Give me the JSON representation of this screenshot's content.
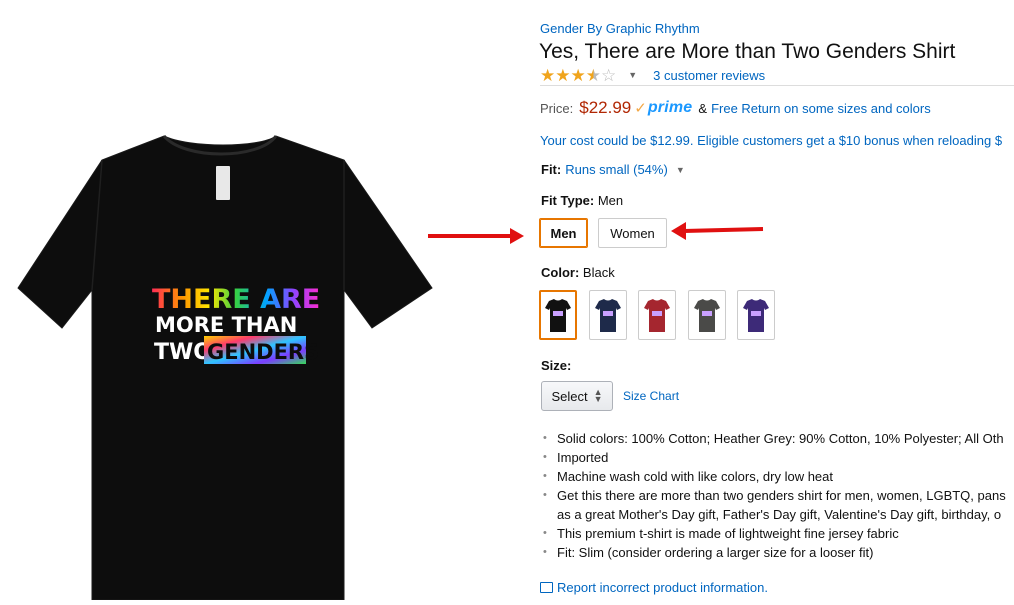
{
  "product": {
    "brand": "Gender By Graphic Rhythm",
    "title": "Yes, There are More than Two Genders Shirt",
    "rating": {
      "stars": 3.5,
      "review_count_label": "3 customer reviews",
      "caret_icon": "chevron-down-icon"
    },
    "price": {
      "label": "Price:",
      "value": "$22.99",
      "prime_label": "prime",
      "amp": "&",
      "free_return": "Free Return on some sizes and colors"
    },
    "cost_line": "Your cost could be $12.99. Eligible customers get a $10 bonus when reloading $",
    "fit": {
      "label": "Fit:",
      "value": "Runs small (54%)"
    },
    "fit_type": {
      "label": "Fit Type:",
      "value": "Men",
      "options": [
        "Men",
        "Women"
      ],
      "selected": "Men"
    },
    "color": {
      "label": "Color:",
      "value": "Black",
      "swatches": [
        "#111111",
        "#1e2a4a",
        "#a5262f",
        "#4a4a48",
        "#3d2a78"
      ]
    },
    "size": {
      "label": "Size:",
      "select_value": "Select",
      "size_chart": "Size Chart"
    },
    "bullets": [
      "Solid colors: 100% Cotton; Heather Grey: 90% Cotton, 10% Polyester; All Oth",
      "Imported",
      "Machine wash cold with like colors, dry low heat",
      "Get this there are more than two genders shirt for men, women, LGBTQ, pans",
      "as a great Mother's Day gift, Father's Day gift, Valentine's Day gift, birthday, o",
      "This premium t-shirt is made of lightweight fine jersey fabric",
      "Fit: Slim (consider ordering a larger size for a looser fit)"
    ],
    "report_link": "Report incorrect product information."
  },
  "shirt_print": {
    "line1": "THERE ARE",
    "line2": "MORE THAN",
    "line3a": "TWO",
    "line3b": "GENDERS"
  },
  "colors": {
    "link": "#0066c0",
    "price": "#b12704",
    "accent_selected": "#e77600",
    "arrow": "#e01010",
    "shirt": "#0d0d0d"
  }
}
